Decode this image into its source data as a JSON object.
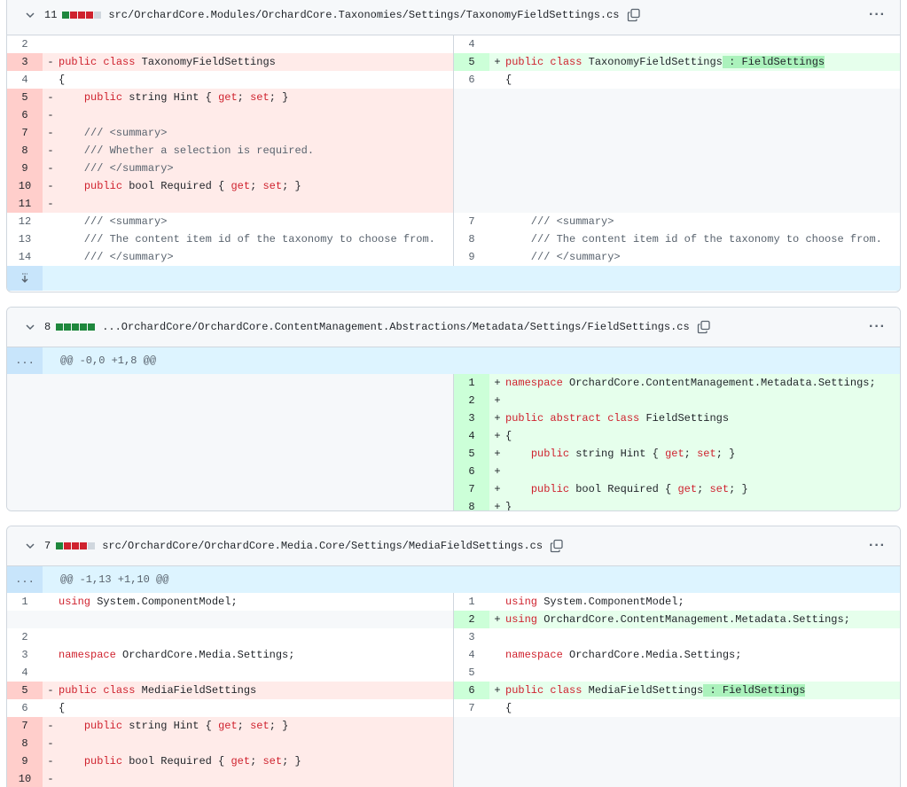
{
  "files": [
    {
      "count": "11",
      "bars": [
        "g",
        "r",
        "r",
        "r",
        "n"
      ],
      "path": "src/OrchardCore.Modules/OrchardCore.Taxonomies/Settings/TaxonomyFieldSettings.cs"
    },
    {
      "count": "8",
      "bars": [
        "g",
        "g",
        "g",
        "g",
        "g"
      ],
      "path": "...OrchardCore/OrchardCore.ContentManagement.Abstractions/Metadata/Settings/FieldSettings.cs",
      "hunk": "@@ -0,0 +1,8 @@",
      "hunk_marker": "..."
    },
    {
      "count": "7",
      "bars": [
        "g",
        "r",
        "r",
        "r",
        "n"
      ],
      "path": "src/OrchardCore/OrchardCore.Media.Core/Settings/MediaFieldSettings.cs",
      "hunk": "@@ -1,13 +1,10 @@",
      "hunk_marker": "..."
    }
  ],
  "f1": {
    "left": [
      {
        "n": "2",
        "s": "",
        "t": "",
        "type": ""
      },
      {
        "n": "3",
        "s": "-",
        "t": "public class TaxonomyFieldSettings",
        "type": "del"
      },
      {
        "n": "4",
        "s": "",
        "t": "{",
        "type": ""
      },
      {
        "n": "5",
        "s": "-",
        "t": "    public string Hint { get; set; }",
        "type": "del"
      },
      {
        "n": "6",
        "s": "-",
        "t": "",
        "type": "del"
      },
      {
        "n": "7",
        "s": "-",
        "t": "    /// <summary>",
        "type": "del"
      },
      {
        "n": "8",
        "s": "-",
        "t": "    /// Whether a selection is required.",
        "type": "del"
      },
      {
        "n": "9",
        "s": "-",
        "t": "    /// </summary>",
        "type": "del"
      },
      {
        "n": "10",
        "s": "-",
        "t": "    public bool Required { get; set; }",
        "type": "del"
      },
      {
        "n": "11",
        "s": "-",
        "t": "",
        "type": "del"
      },
      {
        "n": "12",
        "s": "",
        "t": "    /// <summary>",
        "type": ""
      },
      {
        "n": "13",
        "s": "",
        "t": "    /// The content item id of the taxonomy to choose from.",
        "type": ""
      },
      {
        "n": "14",
        "s": "",
        "t": "    /// </summary>",
        "type": ""
      }
    ],
    "right": [
      {
        "n": "4",
        "s": "",
        "t": "",
        "type": ""
      },
      {
        "n": "5",
        "s": "+",
        "t": "public class TaxonomyFieldSettings",
        "hl": " : FieldSettings",
        "type": "add"
      },
      {
        "n": "6",
        "s": "",
        "t": "{",
        "type": ""
      },
      {
        "n": "",
        "s": "",
        "t": "",
        "type": "empty"
      },
      {
        "n": "",
        "s": "",
        "t": "",
        "type": "empty"
      },
      {
        "n": "",
        "s": "",
        "t": "",
        "type": "empty"
      },
      {
        "n": "",
        "s": "",
        "t": "",
        "type": "empty"
      },
      {
        "n": "",
        "s": "",
        "t": "",
        "type": "empty"
      },
      {
        "n": "",
        "s": "",
        "t": "",
        "type": "empty"
      },
      {
        "n": "",
        "s": "",
        "t": "",
        "type": "empty"
      },
      {
        "n": "7",
        "s": "",
        "t": "    /// <summary>",
        "type": ""
      },
      {
        "n": "8",
        "s": "",
        "t": "    /// The content item id of the taxonomy to choose from.",
        "type": ""
      },
      {
        "n": "9",
        "s": "",
        "t": "    /// </summary>",
        "type": ""
      }
    ]
  },
  "f2": {
    "right": [
      {
        "n": "1",
        "s": "+",
        "t": "namespace OrchardCore.ContentManagement.Metadata.Settings;",
        "type": "add"
      },
      {
        "n": "2",
        "s": "+",
        "t": "",
        "type": "add"
      },
      {
        "n": "3",
        "s": "+",
        "t": "public abstract class FieldSettings",
        "type": "add"
      },
      {
        "n": "4",
        "s": "+",
        "t": "{",
        "type": "add"
      },
      {
        "n": "5",
        "s": "+",
        "t": "    public string Hint { get; set; }",
        "type": "add"
      },
      {
        "n": "6",
        "s": "+",
        "t": "",
        "type": "add"
      },
      {
        "n": "7",
        "s": "+",
        "t": "    public bool Required { get; set; }",
        "type": "add"
      },
      {
        "n": "8",
        "s": "+",
        "t": "}",
        "type": "add"
      }
    ]
  },
  "f3": {
    "left": [
      {
        "n": "1",
        "s": "",
        "t": "using System.ComponentModel;",
        "type": ""
      },
      {
        "n": "",
        "s": "",
        "t": "",
        "type": "empty"
      },
      {
        "n": "2",
        "s": "",
        "t": "",
        "type": ""
      },
      {
        "n": "3",
        "s": "",
        "t": "namespace OrchardCore.Media.Settings;",
        "type": ""
      },
      {
        "n": "4",
        "s": "",
        "t": "",
        "type": ""
      },
      {
        "n": "5",
        "s": "-",
        "t": "public class MediaFieldSettings",
        "type": "del"
      },
      {
        "n": "6",
        "s": "",
        "t": "{",
        "type": ""
      },
      {
        "n": "7",
        "s": "-",
        "t": "    public string Hint { get; set; }",
        "type": "del"
      },
      {
        "n": "8",
        "s": "-",
        "t": "",
        "type": "del"
      },
      {
        "n": "9",
        "s": "-",
        "t": "    public bool Required { get; set; }",
        "type": "del"
      },
      {
        "n": "10",
        "s": "-",
        "t": "",
        "type": "del"
      }
    ],
    "right": [
      {
        "n": "1",
        "s": "",
        "t": "using System.ComponentModel;",
        "type": ""
      },
      {
        "n": "2",
        "s": "+",
        "t": "using OrchardCore.ContentManagement.Metadata.Settings;",
        "type": "add"
      },
      {
        "n": "3",
        "s": "",
        "t": "",
        "type": ""
      },
      {
        "n": "4",
        "s": "",
        "t": "namespace OrchardCore.Media.Settings;",
        "type": ""
      },
      {
        "n": "5",
        "s": "",
        "t": "",
        "type": ""
      },
      {
        "n": "6",
        "s": "+",
        "t": "public class MediaFieldSettings",
        "hl": " : FieldSettings",
        "type": "add"
      },
      {
        "n": "7",
        "s": "",
        "t": "{",
        "type": ""
      },
      {
        "n": "",
        "s": "",
        "t": "",
        "type": "empty"
      },
      {
        "n": "",
        "s": "",
        "t": "",
        "type": "empty"
      },
      {
        "n": "",
        "s": "",
        "t": "",
        "type": "empty"
      },
      {
        "n": "",
        "s": "",
        "t": "",
        "type": "empty"
      }
    ]
  },
  "colors": {
    "added": "#e6ffec",
    "deleted": "#ffebe9",
    "hunk": "#ddf4ff"
  }
}
